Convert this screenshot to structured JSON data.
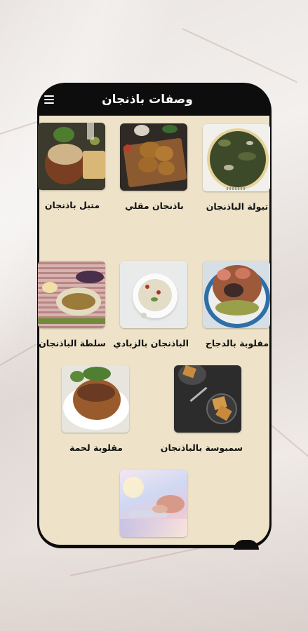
{
  "app": {
    "title": "وصفات باذنجان"
  },
  "icons": {
    "menu": "hamburger-menu-icon"
  },
  "recipes": [
    {
      "label": "تبولة الباذنجان",
      "image": "tabbouleh-eggplant"
    },
    {
      "label": "باذنجان مقلي",
      "image": "fried-eggplant"
    },
    {
      "label": "متبل باذنجان",
      "image": "mutabal-eggplant"
    },
    {
      "label": "مقلوبة بالدجاج",
      "image": "maqluba-chicken"
    },
    {
      "label": "الباذنجان بالزبادي",
      "image": "eggplant-yogurt"
    },
    {
      "label": "سلطة الباذنجان",
      "image": "eggplant-salad"
    },
    {
      "label": "سمبوسة بالباذنجان",
      "image": "samosa-eggplant"
    },
    {
      "label": "مقلوبة لحمة",
      "image": "maqluba-meat"
    },
    {
      "label": "",
      "image": "laptop-hands"
    }
  ],
  "colors": {
    "screen_bg": "#eee3c9",
    "frame": "#0d0d0d",
    "text": "#111111"
  }
}
